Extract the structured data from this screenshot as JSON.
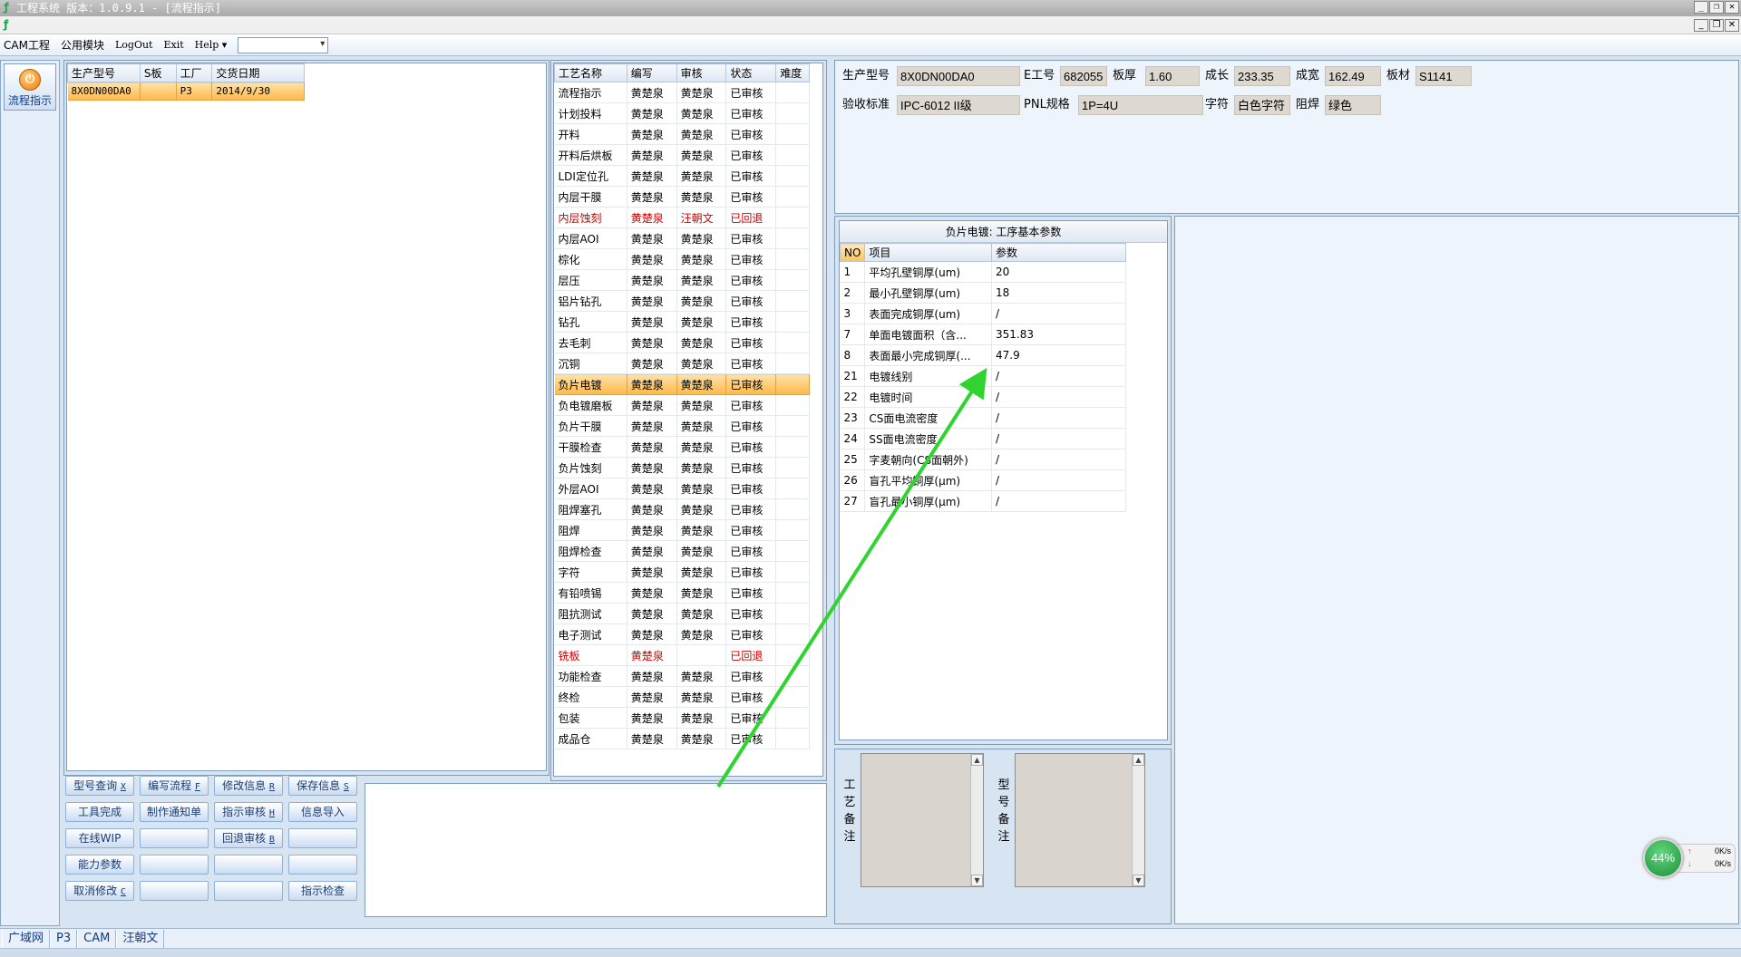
{
  "window": {
    "title": "工程系统  版本：1.0.9.1 - [流程指示]"
  },
  "menu": {
    "items": [
      "CAM工程",
      "公用模块",
      "LogOut",
      "Exit",
      "Help ▾"
    ],
    "combo_value": ""
  },
  "nav": {
    "button_label": "流程指示"
  },
  "orders": {
    "headers": [
      "生产型号",
      "S板",
      "工厂",
      "交货日期"
    ],
    "rows": [
      [
        "8X0DN00DA0",
        "",
        "P3",
        "2014/9/30"
      ]
    ]
  },
  "process": {
    "headers": [
      "工艺名称",
      "编写",
      "审核",
      "状态",
      "难度"
    ],
    "rows": [
      {
        "name": "流程指示",
        "writer": "黄楚泉",
        "reviewer": "黄楚泉",
        "status": "已审核"
      },
      {
        "name": "计划投料",
        "writer": "黄楚泉",
        "reviewer": "黄楚泉",
        "status": "已审核"
      },
      {
        "name": "开料",
        "writer": "黄楚泉",
        "reviewer": "黄楚泉",
        "status": "已审核"
      },
      {
        "name": "开料后烘板",
        "writer": "黄楚泉",
        "reviewer": "黄楚泉",
        "status": "已审核"
      },
      {
        "name": "LDI定位孔",
        "writer": "黄楚泉",
        "reviewer": "黄楚泉",
        "status": "已审核"
      },
      {
        "name": "内层干膜",
        "writer": "黄楚泉",
        "reviewer": "黄楚泉",
        "status": "已审核"
      },
      {
        "name": "内层蚀刻",
        "writer": "黄楚泉",
        "reviewer": "汪朝文",
        "status": "已回退"
      },
      {
        "name": "内层AOI",
        "writer": "黄楚泉",
        "reviewer": "黄楚泉",
        "status": "已审核"
      },
      {
        "name": "棕化",
        "writer": "黄楚泉",
        "reviewer": "黄楚泉",
        "status": "已审核"
      },
      {
        "name": "层压",
        "writer": "黄楚泉",
        "reviewer": "黄楚泉",
        "status": "已审核"
      },
      {
        "name": "铝片钻孔",
        "writer": "黄楚泉",
        "reviewer": "黄楚泉",
        "status": "已审核"
      },
      {
        "name": "钻孔",
        "writer": "黄楚泉",
        "reviewer": "黄楚泉",
        "status": "已审核"
      },
      {
        "name": "去毛刺",
        "writer": "黄楚泉",
        "reviewer": "黄楚泉",
        "status": "已审核"
      },
      {
        "name": "沉铜",
        "writer": "黄楚泉",
        "reviewer": "黄楚泉",
        "status": "已审核"
      },
      {
        "name": "负片电镀",
        "writer": "黄楚泉",
        "reviewer": "黄楚泉",
        "status": "已审核"
      },
      {
        "name": "负电镀磨板",
        "writer": "黄楚泉",
        "reviewer": "黄楚泉",
        "status": "已审核"
      },
      {
        "name": "负片干膜",
        "writer": "黄楚泉",
        "reviewer": "黄楚泉",
        "status": "已审核"
      },
      {
        "name": "干膜检查",
        "writer": "黄楚泉",
        "reviewer": "黄楚泉",
        "status": "已审核"
      },
      {
        "name": "负片蚀刻",
        "writer": "黄楚泉",
        "reviewer": "黄楚泉",
        "status": "已审核"
      },
      {
        "name": "外层AOI",
        "writer": "黄楚泉",
        "reviewer": "黄楚泉",
        "status": "已审核"
      },
      {
        "name": "阻焊塞孔",
        "writer": "黄楚泉",
        "reviewer": "黄楚泉",
        "status": "已审核"
      },
      {
        "name": "阻焊",
        "writer": "黄楚泉",
        "reviewer": "黄楚泉",
        "status": "已审核"
      },
      {
        "name": "阻焊检查",
        "writer": "黄楚泉",
        "reviewer": "黄楚泉",
        "status": "已审核"
      },
      {
        "name": "字符",
        "writer": "黄楚泉",
        "reviewer": "黄楚泉",
        "status": "已审核"
      },
      {
        "name": "有铅喷锡",
        "writer": "黄楚泉",
        "reviewer": "黄楚泉",
        "status": "已审核"
      },
      {
        "name": "阻抗测试",
        "writer": "黄楚泉",
        "reviewer": "黄楚泉",
        "status": "已审核"
      },
      {
        "name": "电子测试",
        "writer": "黄楚泉",
        "reviewer": "黄楚泉",
        "status": "已审核"
      },
      {
        "name": "铣板",
        "writer": "黄楚泉",
        "reviewer": "",
        "status": "已回退"
      },
      {
        "name": "功能检查",
        "writer": "黄楚泉",
        "reviewer": "黄楚泉",
        "status": "已审核"
      },
      {
        "name": "终检",
        "writer": "黄楚泉",
        "reviewer": "黄楚泉",
        "status": "已审核"
      },
      {
        "name": "包装",
        "writer": "黄楚泉",
        "reviewer": "黄楚泉",
        "status": "已审核"
      },
      {
        "name": "成品仓",
        "writer": "黄楚泉",
        "reviewer": "黄楚泉",
        "status": "已审核"
      }
    ]
  },
  "info": {
    "labels": {
      "model": "生产型号",
      "e_no": "E工号",
      "thickness": "板厚",
      "length": "成长",
      "width": "成宽",
      "material": "板材",
      "standard": "验收标准",
      "pnl": "PNL规格",
      "char": "字符",
      "mask": "阻焊"
    },
    "values": {
      "model": "8X0DN00DA0",
      "e_no": "682055",
      "thickness": "1.60",
      "length": "233.35",
      "width": "162.49",
      "material": "S1141",
      "standard": "IPC-6012 II级",
      "pnl": "1P=4U",
      "char": "白色字符",
      "mask": "绿色"
    }
  },
  "params": {
    "title": "负片电镀: 工序基本参数",
    "headers": [
      "NO",
      "项目",
      "参数"
    ],
    "rows": [
      [
        "1",
        "平均孔壁铜厚(um)",
        "20"
      ],
      [
        "2",
        "最小孔壁铜厚(um)",
        "18"
      ],
      [
        "3",
        "表面完成铜厚(um)",
        "/"
      ],
      [
        "7",
        "单面电镀面积（含...",
        "351.83"
      ],
      [
        "8",
        "表面最小完成铜厚(...",
        "47.9"
      ],
      [
        "21",
        "电镀线别",
        "/"
      ],
      [
        "22",
        "电镀时间",
        "/"
      ],
      [
        "23",
        "CS面电流密度",
        "/"
      ],
      [
        "24",
        "SS面电流密度",
        "/"
      ],
      [
        "25",
        "字麦朝向(CS面朝外)",
        "/"
      ],
      [
        "26",
        "盲孔平均铜厚(μm)",
        "/"
      ],
      [
        "27",
        "盲孔最小铜厚(μm)",
        "/"
      ]
    ]
  },
  "notes": {
    "process_label": "工艺备注",
    "model_label": "型号备注"
  },
  "buttons": [
    {
      "label": "型号查询",
      "key": "X"
    },
    {
      "label": "编写流程",
      "key": "F"
    },
    {
      "label": "修改信息",
      "key": "R"
    },
    {
      "label": "保存信息",
      "key": "S"
    },
    {
      "label": "工具完成",
      "key": ""
    },
    {
      "label": "制作通知单",
      "key": ""
    },
    {
      "label": "指示审核",
      "key": "H"
    },
    {
      "label": "信息导入",
      "key": ""
    },
    {
      "label": "在线WIP",
      "key": ""
    },
    {
      "label": "",
      "key": ""
    },
    {
      "label": "回退审核",
      "key": "B"
    },
    {
      "label": "",
      "key": ""
    },
    {
      "label": "能力参数",
      "key": ""
    },
    {
      "label": "",
      "key": ""
    },
    {
      "label": "",
      "key": ""
    },
    {
      "label": "",
      "key": ""
    },
    {
      "label": "取消修改",
      "key": "C"
    },
    {
      "label": "",
      "key": ""
    },
    {
      "label": "",
      "key": ""
    },
    {
      "label": "指示检查",
      "key": ""
    }
  ],
  "status": {
    "items": [
      "广域网",
      "P3",
      "CAM",
      "汪朝文"
    ]
  },
  "net": {
    "percent": "44%",
    "up": "0K/s",
    "down": "0K/s"
  },
  "colors": {
    "selected_row": "#fbb94b",
    "rejected_text": "#d00000",
    "arrow": "#2fd42f"
  }
}
